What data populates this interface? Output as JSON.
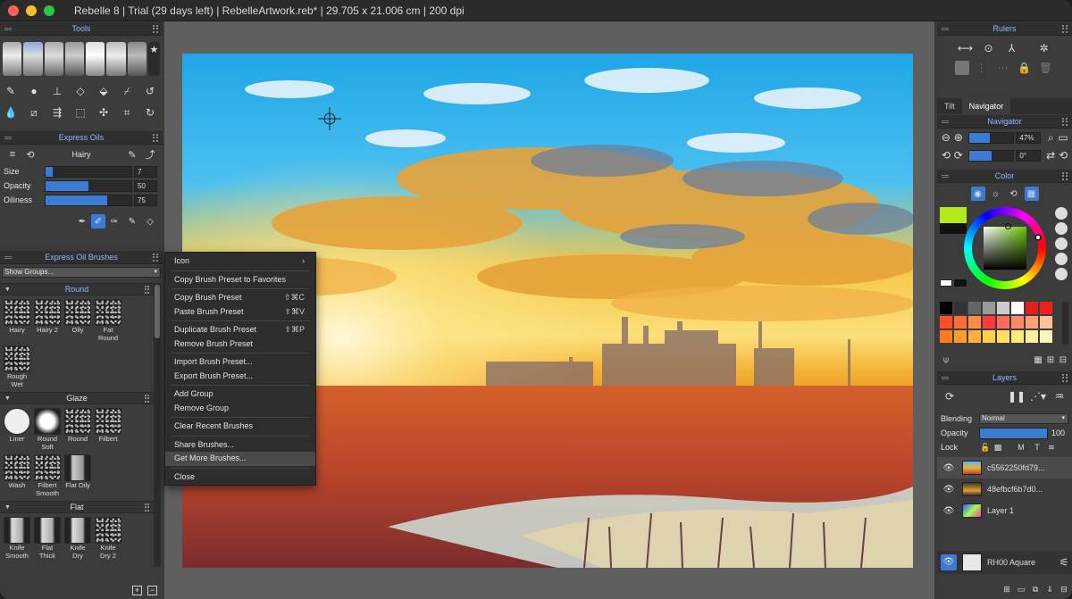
{
  "window": {
    "title": "Rebelle 8 | Trial (29 days left) | RebelleArtwork.reb* | 29.705 x 21.006 cm | 200 dpi"
  },
  "colors": {
    "accent": "#3b7bd4",
    "header_text": "#8fb8ff",
    "close": "#ff5f57",
    "minimize": "#febc2e",
    "maximize": "#28c840",
    "picked_color": "#b2e81c"
  },
  "tools_panel": {
    "title": "Tools",
    "brushes": [
      "pencil-brush",
      "round-brush",
      "ink-pen",
      "wide-brush",
      "marker",
      "airbrush",
      "spray",
      "eraser-brush"
    ],
    "row1_icons": [
      "pencil-icon",
      "blob-icon",
      "stamp-icon",
      "eraser-icon",
      "fill-icon",
      "eyedropper-icon",
      "undo-icon"
    ],
    "row2_icons": [
      "water-drop-icon",
      "ruler-icon",
      "blend-icon",
      "selection-icon",
      "transform-icon",
      "crop-icon",
      "redo-icon"
    ]
  },
  "express_oils": {
    "title": "Express Oils",
    "preset": "Hairy",
    "size_label": "Size",
    "size_value": "7",
    "size_level": 0.08,
    "opacity_label": "Opacity",
    "opacity_value": "50",
    "opacity_level": 0.5,
    "oiliness_label": "Oiliness",
    "oiliness_value": "75",
    "oiliness_level": 0.72
  },
  "brushes_panel": {
    "title": "Express Oil Brushes",
    "show_groups": "Show Groups...",
    "groups": [
      {
        "name": "Round",
        "items": [
          "Hairy",
          "Hairy 2",
          "Oily",
          "Fat Round",
          "Rough Wet"
        ]
      },
      {
        "name": "Glaze",
        "items": [
          "Liner",
          "Round Soft",
          "Round",
          "Filbert",
          "Wash",
          "Filbert Smooth",
          "Flat Oily"
        ]
      },
      {
        "name": "Flat",
        "items": [
          "Knife Smooth",
          "Flat Thick",
          "Knife Dry",
          "Knife Dry 2"
        ]
      }
    ]
  },
  "context_menu": {
    "items": [
      {
        "label": "Icon",
        "shortcut": "",
        "arrow": "›"
      },
      {
        "sep": true
      },
      {
        "label": "Copy Brush Preset to Favorites",
        "shortcut": ""
      },
      {
        "sep": true
      },
      {
        "label": "Copy Brush Preset",
        "shortcut": "⇧⌘C"
      },
      {
        "label": "Paste Brush Preset",
        "shortcut": "⇧⌘V"
      },
      {
        "sep": true
      },
      {
        "label": "Duplicate Brush Preset",
        "shortcut": "⇧⌘P"
      },
      {
        "label": "Remove Brush Preset",
        "shortcut": ""
      },
      {
        "sep": true
      },
      {
        "label": "Import Brush Preset...",
        "shortcut": ""
      },
      {
        "label": "Export Brush Preset...",
        "shortcut": ""
      },
      {
        "sep": true
      },
      {
        "label": "Add Group",
        "shortcut": ""
      },
      {
        "label": "Remove Group",
        "shortcut": ""
      },
      {
        "sep": true
      },
      {
        "label": "Clear Recent Brushes",
        "shortcut": ""
      },
      {
        "sep": true
      },
      {
        "label": "Share Brushes...",
        "shortcut": ""
      },
      {
        "label": "Get More Brushes...",
        "shortcut": "",
        "highlight": true
      },
      {
        "sep": true
      },
      {
        "label": "Close",
        "shortcut": ""
      }
    ]
  },
  "rulers": {
    "title": "Rulers"
  },
  "nav_tabs": [
    "Tilt",
    "Navigator"
  ],
  "navigator": {
    "title": "Navigator",
    "zoom": "47%",
    "zoom_level": 0.47,
    "rotation": "0°",
    "rotation_level": 0.5
  },
  "color": {
    "title": "Color"
  },
  "layers": {
    "title": "Layers",
    "blending_label": "Blending",
    "blending_value": "Normal",
    "opacity_label": "Opacity",
    "opacity_value": "100",
    "opacity_level": 1.0,
    "lock_label": "Lock",
    "items": [
      {
        "name": "c5562250fd79..."
      },
      {
        "name": "48efbcf6b7d0..."
      },
      {
        "name": "Layer 1"
      }
    ],
    "paper": "RH00 Aquare"
  }
}
